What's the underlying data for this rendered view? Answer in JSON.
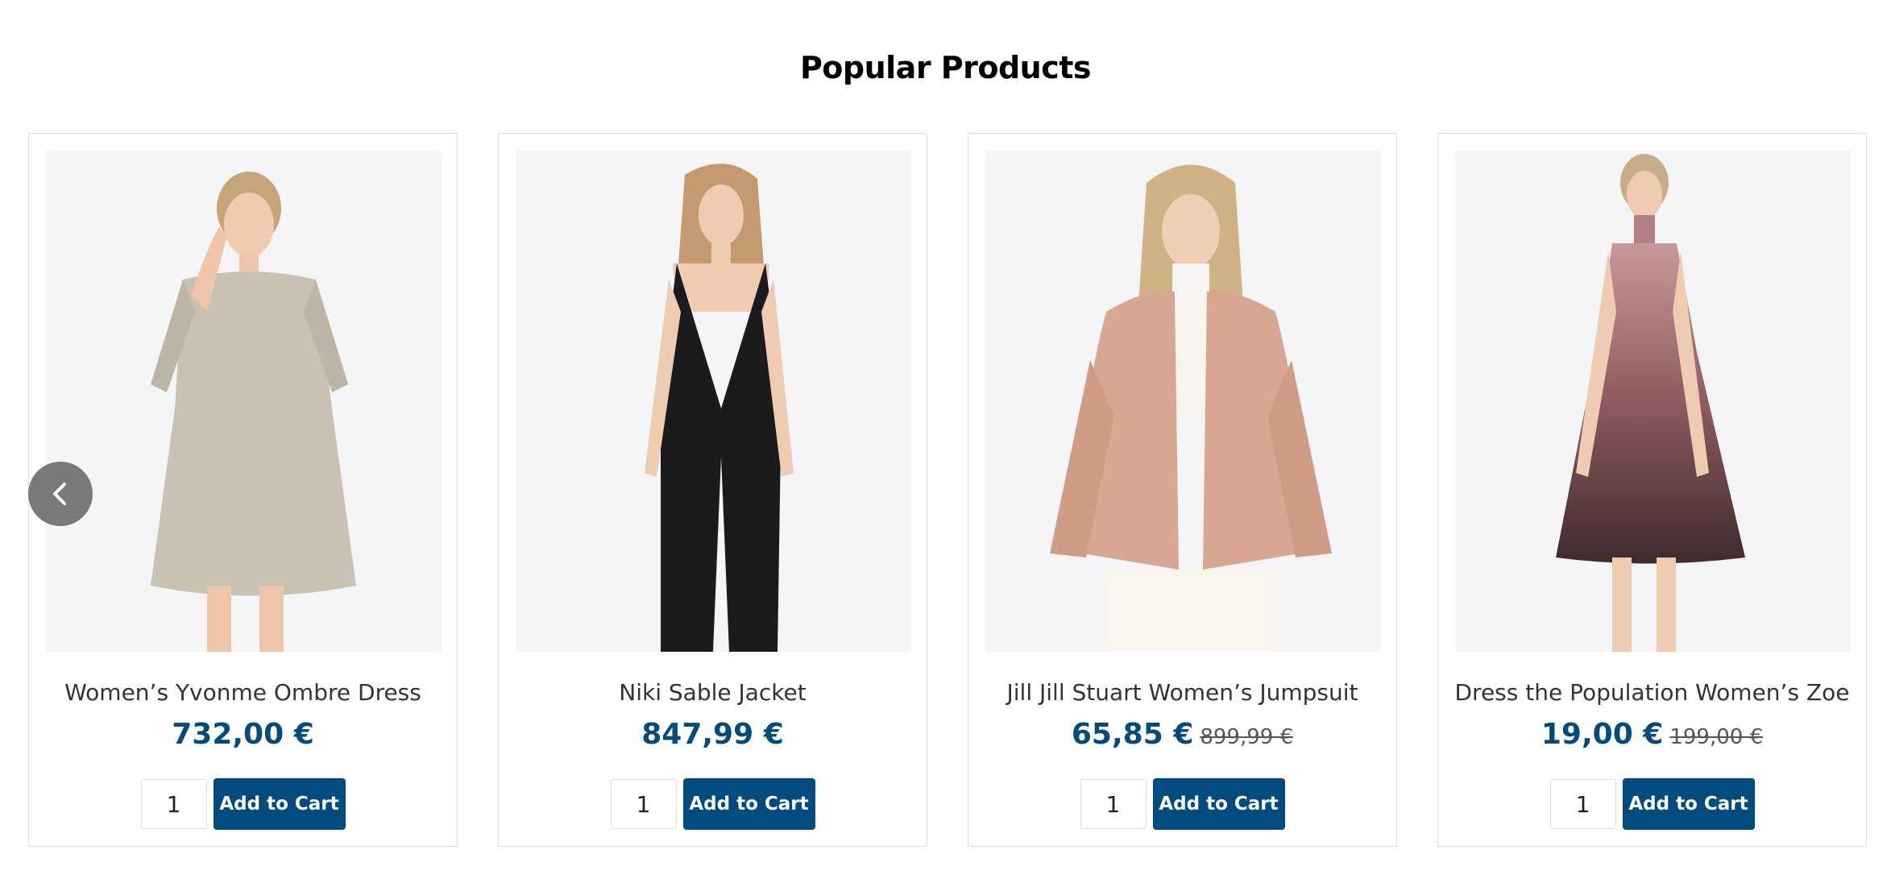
{
  "section": {
    "title": "Popular Products"
  },
  "colors": {
    "accent": "#034b7f",
    "image_bg": "#f5f4f6",
    "border": "#dddddd"
  },
  "carousel": {
    "prev_icon": "chevron-left-icon",
    "products": [
      {
        "title": "Women’s Yvonme Ombre Dress",
        "price": "732,00 €",
        "old_price": "",
        "qty": "1",
        "button": "Add to Cart",
        "image": "model-silver-shift-dress"
      },
      {
        "title": "Niki Sable Jacket",
        "price": "847,99 €",
        "old_price": "",
        "qty": "1",
        "button": "Add to Cart",
        "image": "model-black-halter-jumpsuit"
      },
      {
        "title": "Jill Jill Stuart Women’s Jumpsuit",
        "price": "65,85 €",
        "old_price": "899,99 €",
        "qty": "1",
        "button": "Add to Cart",
        "image": "model-pink-fur-jacket"
      },
      {
        "title": "Dress the Population Women’s Zoe",
        "price": "19,00 €",
        "old_price": "199,00 €",
        "qty": "1",
        "button": "Add to Cart",
        "image": "model-ombre-halter-dress"
      }
    ]
  }
}
